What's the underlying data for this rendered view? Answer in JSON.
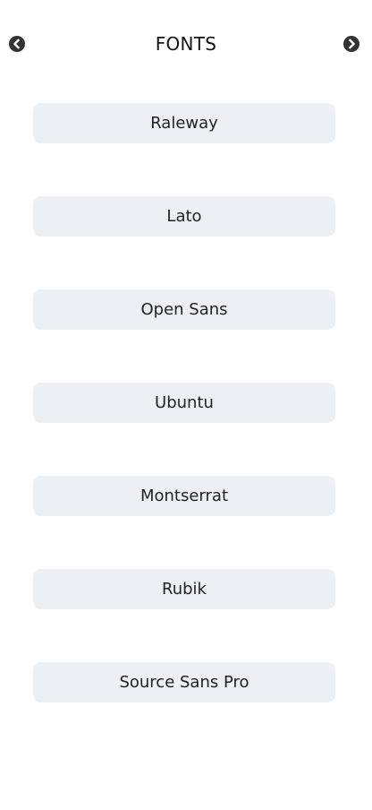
{
  "header": {
    "title": "FONTS",
    "prev_icon": "chevron-left-circle",
    "next_icon": "chevron-right-circle"
  },
  "fonts": [
    {
      "label": "Raleway"
    },
    {
      "label": "Lato"
    },
    {
      "label": "Open Sans"
    },
    {
      "label": "Ubuntu"
    },
    {
      "label": "Montserrat"
    },
    {
      "label": "Rubik"
    },
    {
      "label": "Source Sans Pro"
    }
  ],
  "colors": {
    "item_background": "#ecf0f4",
    "text": "#222222",
    "icon": "#333333"
  }
}
